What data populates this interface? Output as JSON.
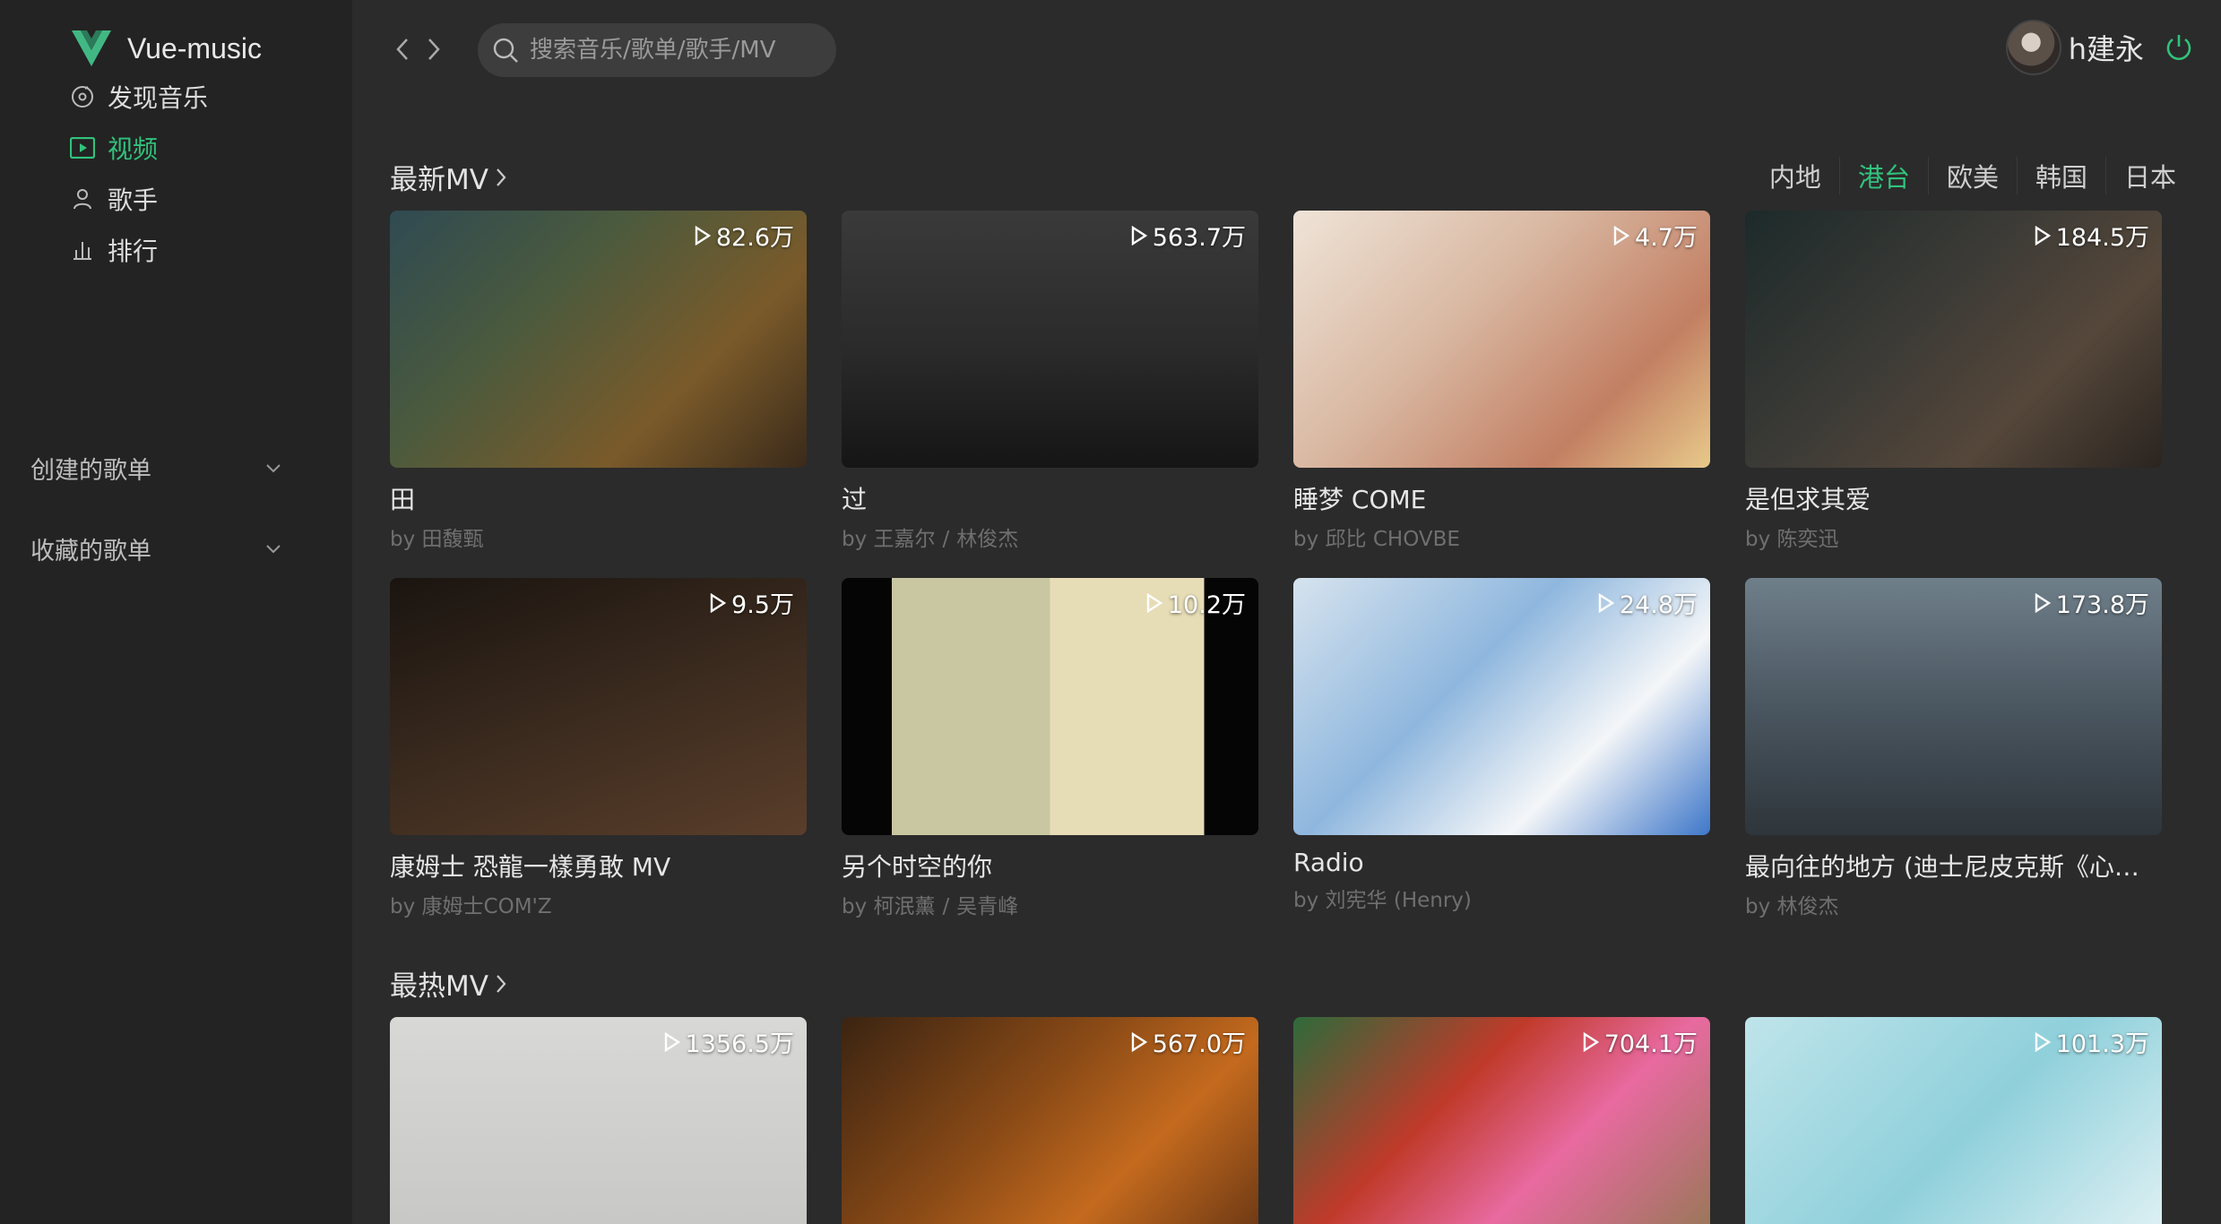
{
  "app": {
    "name": "Vue-music",
    "brand_color": "#31c27c"
  },
  "sidebar": {
    "items": [
      {
        "label": "发现音乐",
        "icon": "disc-icon",
        "active": false
      },
      {
        "label": "视频",
        "icon": "video-icon",
        "active": true
      },
      {
        "label": "歌手",
        "icon": "singer-icon",
        "active": false
      },
      {
        "label": "排行",
        "icon": "chart-icon",
        "active": false
      }
    ],
    "sections": [
      {
        "label": "创建的歌单"
      },
      {
        "label": "收藏的歌单"
      }
    ]
  },
  "topbar": {
    "search_placeholder": "搜索音乐/歌单/歌手/MV",
    "username": "h建永"
  },
  "latest": {
    "title": "最新MV",
    "tabs": [
      "内地",
      "港台",
      "欧美",
      "韩国",
      "日本"
    ],
    "active_tab": "港台",
    "cards": [
      {
        "plays": "82.6万",
        "title": "田",
        "artists": [
          "田馥甄"
        ]
      },
      {
        "plays": "563.7万",
        "title": "过",
        "artists": [
          "王嘉尔",
          "林俊杰"
        ]
      },
      {
        "plays": "4.7万",
        "title": "睡梦 COME",
        "artists": [
          "邱比 CHOVBE"
        ]
      },
      {
        "plays": "184.5万",
        "title": "是但求其爱",
        "artists": [
          "陈奕迅"
        ]
      },
      {
        "plays": "9.5万",
        "title": "康姆士 恐龍一樣勇敢 MV",
        "artists": [
          "康姆士COM'Z"
        ]
      },
      {
        "plays": "10.2万",
        "title": "另个时空的你",
        "artists": [
          "柯泯薰",
          "吴青峰"
        ]
      },
      {
        "plays": "24.8万",
        "title": "Radio",
        "artists": [
          "刘宪华 (Henry)"
        ]
      },
      {
        "plays": "173.8万",
        "title": "最向往的地方 (迪士尼皮克斯《心灵奇旅》中文主题曲)",
        "artists": [
          "林俊杰"
        ]
      }
    ]
  },
  "hot": {
    "title": "最热MV",
    "cards": [
      {
        "plays": "1356.5万"
      },
      {
        "plays": "567.0万"
      },
      {
        "plays": "704.1万"
      },
      {
        "plays": "101.3万"
      }
    ]
  },
  "thumb_gradients": [
    "linear-gradient(135deg,#2f4a52 0%,#4a5a3e 35%,#7a5a2a 70%,#3a2a1a 100%)",
    "linear-gradient(180deg,#3a3a3a 0%,#2a2a2a 55%,#151515 100%)",
    "linear-gradient(135deg,#efe4d8 0%,#d9b8a2 40%,#c27f63 75%,#e8c98a 100%)",
    "linear-gradient(135deg,#1d2a2a 0%,#3b3a36 40%,#55473a 70%,#2a2420 100%)",
    "linear-gradient(160deg,#1a1410 0%,#3a2a1e 50%,#5a3e2a 100%)",
    "linear-gradient(90deg,#050505 0 12%,#c9c7a2 12% 50%,#e6dcb6 50% 87%,#050505 87%)",
    "linear-gradient(135deg,#d6e3ee 0%,#8fb7de 40%,#f4f6f8 70%,#3e77c9 100%)",
    "linear-gradient(180deg,#6f7f8a 0%,#4a5660 50%,#2e353b 100%)",
    "linear-gradient(180deg,#d8d8d6 0%,#c4c4c2 100%)",
    "linear-gradient(135deg,#3b2412 0%,#8a4a16 40%,#c46a1e 65%,#5a2e12 100%)",
    "linear-gradient(135deg,#2e6a3a 0%,#c03a2a 35%,#e86aa0 60%,#8a7a4a 100%)",
    "linear-gradient(135deg,#bfe4ea 0%,#8fd0db 50%,#e9f5f7 100%)"
  ]
}
